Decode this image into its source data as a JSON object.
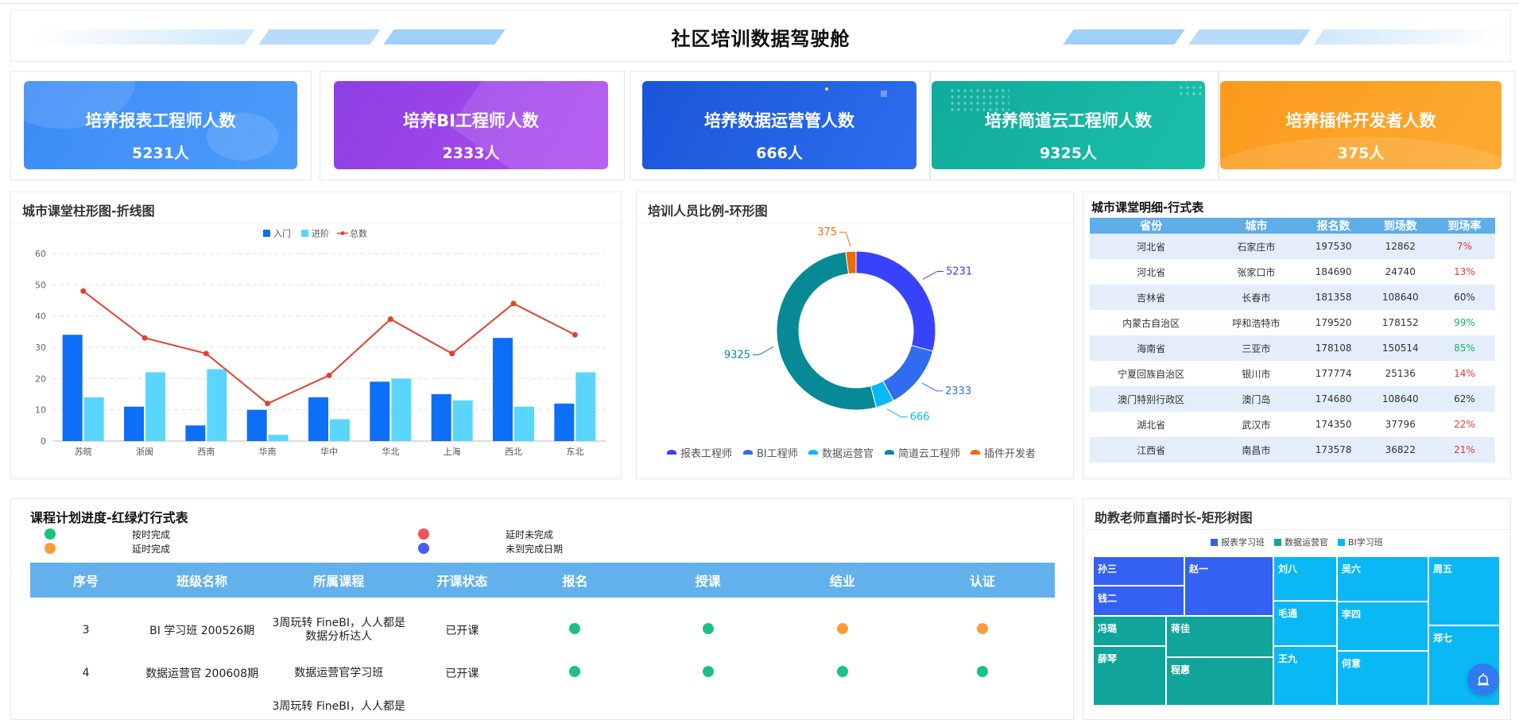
{
  "header": {
    "title": "社区培训数据驾驶舱"
  },
  "kpis": [
    {
      "label": "培养报表工程师人数",
      "value": "5231人",
      "color1": "#3b8bf7",
      "color2": "#4c9cfb"
    },
    {
      "label": "培养BI工程师人数",
      "value": "2333人",
      "color1": "#8c3fe3",
      "color2": "#b04cef"
    },
    {
      "label": "培养数据运营管人数",
      "value": "666人",
      "color1": "#1a55d8",
      "color2": "#2d6ef0"
    },
    {
      "label": "培养简道云工程师人数",
      "value": "9325人",
      "color1": "#10ab9c",
      "color2": "#1bbfa9"
    },
    {
      "label": "培养插件开发者人数",
      "value": "375人",
      "color1": "#fb9a1c",
      "color2": "#fdaa32"
    }
  ],
  "bar_panel": {
    "title": "城市课堂柱形图-折线图"
  },
  "donut_panel": {
    "title": "培训人员比例-环形图"
  },
  "city_table": {
    "title": "城市课堂明细-行式表",
    "headers": [
      "省份",
      "城市",
      "报名数",
      "到场数",
      "到场率"
    ],
    "rows": [
      {
        "province": "河北省",
        "city": "石家庄市",
        "signup": "197530",
        "attend": "12862",
        "rate": "7%",
        "good": false
      },
      {
        "province": "河北省",
        "city": "张家口市",
        "signup": "184690",
        "attend": "24740",
        "rate": "13%",
        "good": false
      },
      {
        "province": "吉林省",
        "city": "长春市",
        "signup": "181358",
        "attend": "108640",
        "rate": "60%",
        "good": null
      },
      {
        "province": "内蒙古自治区",
        "city": "呼和浩特市",
        "signup": "179520",
        "attend": "178152",
        "rate": "99%",
        "good": true
      },
      {
        "province": "海南省",
        "city": "三亚市",
        "signup": "178108",
        "attend": "150514",
        "rate": "85%",
        "good": true
      },
      {
        "province": "宁夏回族自治区",
        "city": "银川市",
        "signup": "177774",
        "attend": "25136",
        "rate": "14%",
        "good": false
      },
      {
        "province": "澳门特别行政区",
        "city": "澳门岛",
        "signup": "174680",
        "attend": "108640",
        "rate": "62%",
        "good": null
      },
      {
        "province": "湖北省",
        "city": "武汉市",
        "signup": "174350",
        "attend": "37796",
        "rate": "22%",
        "good": false
      },
      {
        "province": "江西省",
        "city": "南昌市",
        "signup": "173578",
        "attend": "36822",
        "rate": "21%",
        "good": false
      }
    ]
  },
  "plan": {
    "title": "课程计划进度-红绿灯行式表",
    "legend": [
      {
        "label": "按时完成",
        "color": "#19c37d"
      },
      {
        "label": "延时未完成",
        "color": "#f0525a"
      },
      {
        "label": "延时完成",
        "color": "#f99d3c"
      },
      {
        "label": "未到完成日期",
        "color": "#4b5df0"
      }
    ],
    "headers": [
      "序号",
      "班级名称",
      "所属课程",
      "开课状态",
      "报名",
      "授课",
      "结业",
      "认证"
    ],
    "rows": [
      {
        "no": "3",
        "cls": "BI 学习班 200526期",
        "course": "3周玩转 FineBI，人人都是数据分析达人",
        "status": "已开课",
        "s": [
          "#19c37d",
          "#19c37d",
          "#f99d3c",
          "#f99d3c"
        ]
      },
      {
        "no": "4",
        "cls": "数据运营官 200608期",
        "course": "数据运营官学习班",
        "status": "已开课",
        "s": [
          "#19c37d",
          "#19c37d",
          "#19c37d",
          "#19c37d"
        ]
      }
    ],
    "partial_course": "3周玩转 FineBI，人人都是"
  },
  "treemap": {
    "title": "助教老师直播时长-矩形树图",
    "legend": [
      "报表学习班",
      "数据运营官",
      "BI学习班"
    ],
    "colors": [
      "#3561f2",
      "#10a49a",
      "#0ab8f5"
    ],
    "cells": [
      "孙三",
      "钱二",
      "赵一",
      "冯璐",
      "薛琴",
      "蒋佳",
      "程惠",
      "刘八",
      "毛通",
      "王九",
      "吴六",
      "李四",
      "何意",
      "周五",
      "郑七"
    ]
  },
  "chart_data": [
    {
      "type": "bar",
      "categories": [
        "苏皖",
        "浙闽",
        "西南",
        "华南",
        "华中",
        "华北",
        "上海",
        "西北",
        "东北"
      ],
      "series": [
        {
          "name": "入门",
          "type": "bar",
          "color": "#0d6ef8",
          "values": [
            34,
            11,
            5,
            10,
            14,
            19,
            15,
            33,
            12
          ]
        },
        {
          "name": "进阶",
          "type": "bar",
          "color": "#5ad6fd",
          "values": [
            14,
            22,
            23,
            2,
            7,
            20,
            13,
            11,
            22
          ]
        },
        {
          "name": "总数",
          "type": "line",
          "color": "#e2422f",
          "values": [
            48,
            33,
            28,
            12,
            21,
            39,
            28,
            44,
            34
          ]
        }
      ],
      "yticks": [
        "0",
        "10",
        "20",
        "30",
        "40",
        "50",
        "60"
      ],
      "ylim": [
        0,
        60
      ],
      "legend": "top-center",
      "grid": true
    },
    {
      "type": "pie",
      "donut": true,
      "labels": [
        "报表工程师",
        "BI工程师",
        "数据运营官",
        "简道云工程师",
        "插件开发者"
      ],
      "values": [
        5231,
        2333,
        666,
        9325,
        375
      ],
      "value_labels": [
        "5231",
        "2333",
        "666",
        "9325",
        "375"
      ],
      "colors": [
        "#3742fa",
        "#2f6cf0",
        "#0ab8f5",
        "#078a96",
        "#ef6b0b"
      ],
      "legend": "bottom"
    }
  ]
}
